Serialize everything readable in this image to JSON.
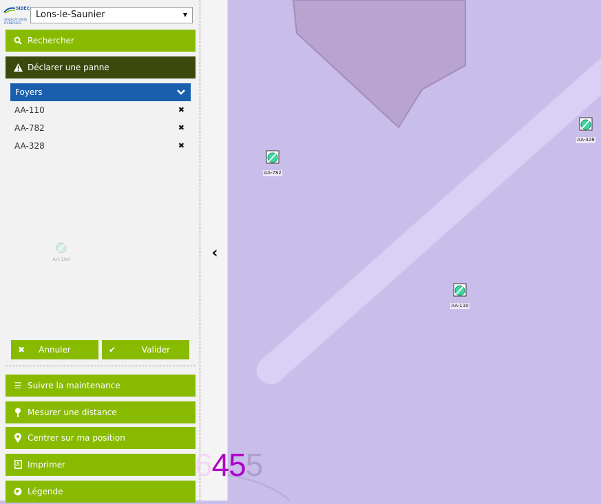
{
  "header": {
    "logo_text": "SIDEC",
    "logo_sub": "du Jura",
    "logo_line": "SYNDICAT MIXTE D'ENERGIES",
    "city_select_value": "Lons-le-Saunier"
  },
  "menu": {
    "search": "Rechercher",
    "declare": "Déclarer une panne",
    "maintenance": "Suivre la maintenance",
    "measure": "Mesurer une distance",
    "center": "Centrer sur ma position",
    "print": "Imprimer",
    "legend": "Légende"
  },
  "foyers": {
    "header": "Foyers",
    "items": [
      "AA-110",
      "AA-782",
      "AA-328"
    ]
  },
  "faded_marker_label": "AA-164",
  "actions": {
    "cancel": "Annuler",
    "validate": "Valider"
  },
  "map": {
    "markers": [
      {
        "label": "AA-782"
      },
      {
        "label": "AA-328"
      },
      {
        "label": "AA-110"
      }
    ],
    "overlay_number_ghost": "6",
    "overlay_number_main": "45",
    "overlay_number_tail": "5"
  },
  "colors": {
    "green": "#88ba00",
    "dark_green": "#3b4a0c",
    "blue": "#1a5fae",
    "map_bg": "#c9bde9"
  },
  "icons": {
    "search": "search-icon",
    "warning": "warning-icon",
    "list": "list-icon",
    "pin": "map-pin-icon",
    "location": "location-icon",
    "pdf": "pdf-icon",
    "globe": "globe-icon"
  }
}
